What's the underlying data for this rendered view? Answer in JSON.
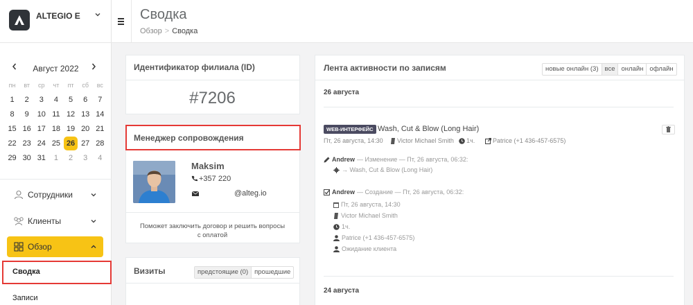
{
  "brand": {
    "name": "ALTEGIO E"
  },
  "calendar": {
    "month_label": "Август 2022",
    "weekdays": [
      "пн",
      "вт",
      "ср",
      "чт",
      "пт",
      "сб",
      "вс"
    ],
    "weeks": [
      [
        "1",
        "2",
        "3",
        "4",
        "5",
        "6",
        "7"
      ],
      [
        "8",
        "9",
        "10",
        "11",
        "12",
        "13",
        "14"
      ],
      [
        "15",
        "16",
        "17",
        "18",
        "19",
        "20",
        "21"
      ],
      [
        "22",
        "23",
        "24",
        "25",
        "26",
        "27",
        "28"
      ],
      [
        "29",
        "30",
        "31",
        "1",
        "2",
        "3",
        "4"
      ]
    ],
    "today": "26"
  },
  "sidebar": {
    "items": [
      {
        "label": "Сотрудники"
      },
      {
        "label": "Клиенты"
      },
      {
        "label": "Обзор"
      }
    ],
    "sub_items": [
      {
        "label": "Сводка"
      },
      {
        "label": "Записи"
      }
    ]
  },
  "header": {
    "title": "Сводка",
    "breadcrumb": [
      "Обзор",
      "Сводка"
    ],
    "breadcrumb_sep": ">"
  },
  "branch_card": {
    "title": "Идентификатор филиала (ID)",
    "value": "#7206"
  },
  "manager_card": {
    "title": "Менеджер сопровождения",
    "name": "Maksim",
    "phone": "+357 220",
    "email": "@alteg.io",
    "note": "Поможет заключить договор и решить вопросы с оплатой"
  },
  "visits_card": {
    "title": "Визиты",
    "filters": [
      "предстоящие (0)",
      "прошедшие"
    ]
  },
  "activity": {
    "title": "Лента активности по записям",
    "filters": [
      "новые онлайн (3)",
      "все",
      "онлайн",
      "офлайн"
    ],
    "active_filter": "все",
    "groups": [
      {
        "date": "26 августа",
        "entry": {
          "source_badge": "WEB-ИНТЕРФЕЙС",
          "service": "Wash, Cut & Blow (Long Hair)",
          "datetime": "Пт, 26 августа, 14:30",
          "staff": "Victor Michael Smith",
          "duration": "1ч.",
          "client": "Patrice (+1 436-457-6575)"
        },
        "log": [
          {
            "author": "Andrew",
            "action": "— Изменение — Пт, 26 августа, 06:32:",
            "changes": [
              "→ Wash, Cut & Blow (Long Hair)"
            ]
          },
          {
            "author": "Andrew",
            "action": "— Создание — Пт, 26 августа, 06:32:",
            "changes": [
              "Пт, 26 августа, 14:30",
              "Victor Michael Smith",
              "1ч.",
              "Patrice (+1 436-457-6575)",
              "Ожидание клиента"
            ]
          }
        ]
      },
      {
        "date": "24 августа"
      }
    ]
  },
  "colors": {
    "accent": "#f7c315",
    "highlight_border": "#e53935",
    "badge": "#4b4b61"
  }
}
